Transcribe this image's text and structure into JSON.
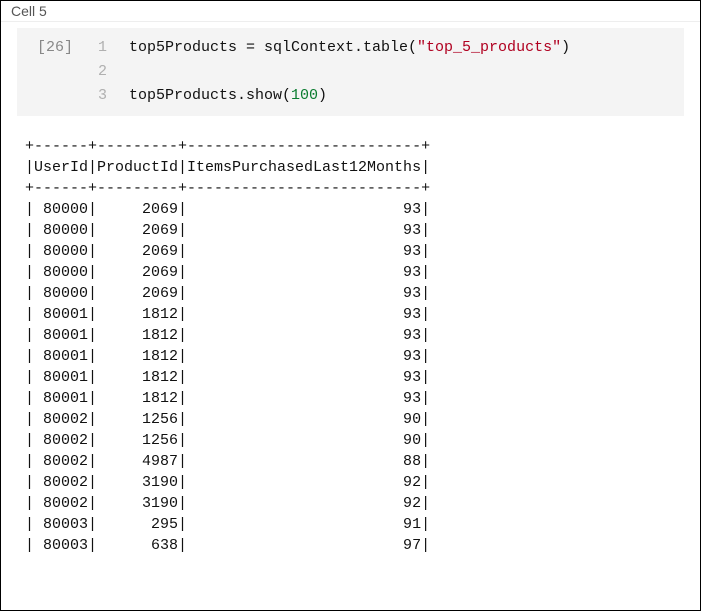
{
  "cell": {
    "title": "Cell 5",
    "exec_count": "[26]",
    "line_numbers": [
      "1",
      "2",
      "3"
    ],
    "code": {
      "line1_pre": "top5Products = sqlContext.table(",
      "line1_str": "\"top_5_products\"",
      "line1_post": ")",
      "line2": "",
      "line3_pre": "top5Products.show(",
      "line3_num": "100",
      "line3_post": ")"
    }
  },
  "table": {
    "sep": "+------+---------+--------------------------+",
    "header": "|UserId|ProductId|ItemsPurchasedLast12Months|",
    "rows": [
      {
        "UserId": "80000",
        "ProductId": "2069",
        "Items": "93"
      },
      {
        "UserId": "80000",
        "ProductId": "2069",
        "Items": "93"
      },
      {
        "UserId": "80000",
        "ProductId": "2069",
        "Items": "93"
      },
      {
        "UserId": "80000",
        "ProductId": "2069",
        "Items": "93"
      },
      {
        "UserId": "80000",
        "ProductId": "2069",
        "Items": "93"
      },
      {
        "UserId": "80001",
        "ProductId": "1812",
        "Items": "93"
      },
      {
        "UserId": "80001",
        "ProductId": "1812",
        "Items": "93"
      },
      {
        "UserId": "80001",
        "ProductId": "1812",
        "Items": "93"
      },
      {
        "UserId": "80001",
        "ProductId": "1812",
        "Items": "93"
      },
      {
        "UserId": "80001",
        "ProductId": "1812",
        "Items": "93"
      },
      {
        "UserId": "80002",
        "ProductId": "1256",
        "Items": "90"
      },
      {
        "UserId": "80002",
        "ProductId": "1256",
        "Items": "90"
      },
      {
        "UserId": "80002",
        "ProductId": "4987",
        "Items": "88"
      },
      {
        "UserId": "80002",
        "ProductId": "3190",
        "Items": "92"
      },
      {
        "UserId": "80002",
        "ProductId": "3190",
        "Items": "92"
      },
      {
        "UserId": "80003",
        "ProductId": "295",
        "Items": "91"
      },
      {
        "UserId": "80003",
        "ProductId": "638",
        "Items": "97"
      }
    ]
  }
}
